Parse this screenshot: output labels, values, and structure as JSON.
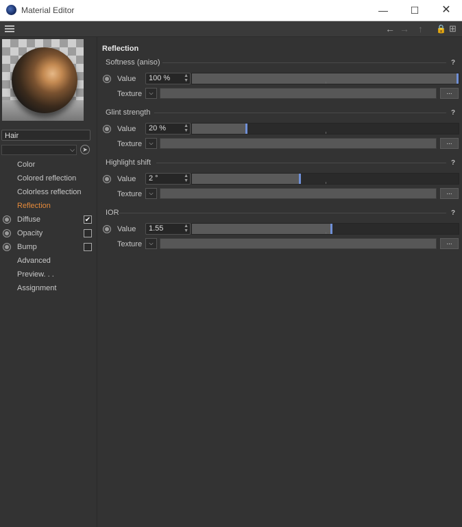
{
  "window": {
    "title": "Material Editor",
    "minimize_icon": "minimize-icon",
    "maximize_icon": "maximize-icon",
    "close_icon": "close-icon"
  },
  "toolbar": {
    "icons": [
      "menu-icon",
      "back-arrow-icon",
      "forward-arrow-icon",
      "up-arrow-icon",
      "lock-icon",
      "new-window-icon"
    ]
  },
  "material": {
    "name": "Hair",
    "dropdown_value": ""
  },
  "channels": [
    {
      "label": "Color",
      "has_radio": false,
      "checkbox": null,
      "active": false
    },
    {
      "label": "Colored reflection",
      "has_radio": false,
      "checkbox": null,
      "active": false
    },
    {
      "label": "Colorless reflection",
      "has_radio": false,
      "checkbox": null,
      "active": false
    },
    {
      "label": "Reflection",
      "has_radio": false,
      "checkbox": null,
      "active": true
    },
    {
      "label": "Diffuse",
      "has_radio": true,
      "checkbox": true,
      "active": false
    },
    {
      "label": "Opacity",
      "has_radio": true,
      "checkbox": false,
      "active": false
    },
    {
      "label": "Bump",
      "has_radio": true,
      "checkbox": false,
      "active": false
    },
    {
      "label": "Advanced",
      "has_radio": false,
      "checkbox": null,
      "active": false
    },
    {
      "label": "Preview. . .",
      "has_radio": false,
      "checkbox": null,
      "active": false
    },
    {
      "label": "Assignment",
      "has_radio": false,
      "checkbox": null,
      "active": false
    }
  ],
  "panel": {
    "title": "Reflection",
    "value_label": "Value",
    "texture_label": "Texture",
    "help": "?",
    "more": "...",
    "groups": [
      {
        "name": "Softness (aniso)",
        "value": "100 %",
        "level": 1.0
      },
      {
        "name": "Glint strength",
        "value": "20 %",
        "level": 0.2
      },
      {
        "name": "Highlight shift",
        "value": "2 °",
        "level": 0.4
      },
      {
        "name": "IOR",
        "value": "1.55",
        "level": 0.52
      }
    ]
  },
  "colors": {
    "accent": "#e58a3a",
    "slider_knob": "#6f8fd6",
    "background": "#333333"
  }
}
